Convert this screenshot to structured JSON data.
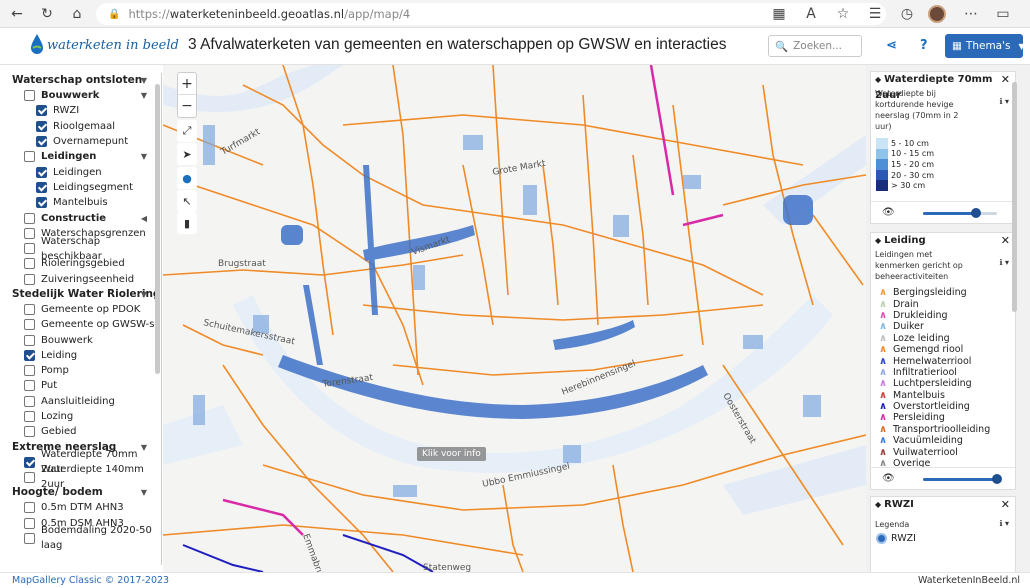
{
  "browser": {
    "url_prefix": "https://",
    "url_host": "waterketeninbeeld.geoatlas.nl",
    "url_path": "/app/map/4"
  },
  "header": {
    "logo_text": "waterketen in beeld",
    "title": "3 Afvalwaterketen van gemeenten en waterschappen op GWSW en interacties",
    "search_placeholder": "Zoeken...",
    "themas_label": "Thema's"
  },
  "left_panel": {
    "sections": [
      {
        "title": "Waterschap ontsloten",
        "rows": [
          {
            "label": "Bouwwerk",
            "level": 1,
            "bold": true,
            "checked": false,
            "arrow": "▼"
          },
          {
            "label": "RWZI",
            "level": 2,
            "checked": true
          },
          {
            "label": "Rioolgemaal",
            "level": 2,
            "checked": true
          },
          {
            "label": "Overnamepunt",
            "level": 2,
            "checked": true
          },
          {
            "label": "Leidingen",
            "level": 1,
            "bold": true,
            "checked": false,
            "arrow": "▼"
          },
          {
            "label": "Leidingen",
            "level": 2,
            "checked": true
          },
          {
            "label": "Leidingsegment",
            "level": 2,
            "checked": true
          },
          {
            "label": "Mantelbuis",
            "level": 2,
            "checked": true
          },
          {
            "label": "Constructie",
            "level": 1,
            "bold": true,
            "checked": false,
            "arrow": "◀"
          },
          {
            "label": "Waterschapsgrenzen",
            "level": 1,
            "checked": false
          },
          {
            "label": "Waterschap beschikbaar",
            "level": 1,
            "checked": false
          },
          {
            "label": "Rioleringsgebied",
            "level": 1,
            "checked": false
          },
          {
            "label": "Zuiveringseenheid",
            "level": 1,
            "checked": false
          }
        ]
      },
      {
        "title": "Stedelijk Water Riolering",
        "rows": [
          {
            "label": "Gemeente op PDOK",
            "level": 1,
            "checked": false
          },
          {
            "label": "Gemeente op GWSW-s",
            "level": 1,
            "checked": false
          },
          {
            "label": "Bouwwerk",
            "level": 1,
            "checked": false
          },
          {
            "label": "Leiding",
            "level": 1,
            "checked": true
          },
          {
            "label": "Pomp",
            "level": 1,
            "checked": false
          },
          {
            "label": "Put",
            "level": 1,
            "checked": false
          },
          {
            "label": "Aansluitleiding",
            "level": 1,
            "checked": false
          },
          {
            "label": "Lozing",
            "level": 1,
            "checked": false
          },
          {
            "label": "Gebied",
            "level": 1,
            "checked": false
          }
        ]
      },
      {
        "title": "Extreme neerslag",
        "rows": [
          {
            "label": "Waterdiepte 70mm 2uur",
            "level": 1,
            "checked": true
          },
          {
            "label": "Waterdiepte 140mm 2uur",
            "level": 1,
            "checked": false
          }
        ]
      },
      {
        "title": "Hoogte/ bodem",
        "rows": [
          {
            "label": "0.5m DTM AHN3",
            "level": 1,
            "checked": false
          },
          {
            "label": "0.5m DSM AHN3",
            "level": 1,
            "checked": false
          },
          {
            "label": "Bodemdaling 2020-50 laag",
            "level": 1,
            "checked": false
          }
        ]
      }
    ]
  },
  "map": {
    "info_label": "Klik voor info",
    "streets": [
      "Brugstraat",
      "Turfmarkt",
      "Vismarkt",
      "Torenstraat",
      "Schuitemakersstraat",
      "Ubbo Emmiussingel",
      "Herebinnensingel",
      "Oosterstraat",
      "Statenweg",
      "Emmabrug",
      "Grote Markt"
    ]
  },
  "right_panel": {
    "waterdiepte": {
      "title": "Waterdiepte 70mm 2uur",
      "desc": "Waterdiepte bij kortdurende hevige neerslag (70mm in 2 uur)",
      "legend": [
        {
          "label": "5 - 10 cm",
          "color": "#c9e4f5"
        },
        {
          "label": "10 - 15 cm",
          "color": "#8ec3ea"
        },
        {
          "label": "15 - 20 cm",
          "color": "#4f8fd6"
        },
        {
          "label": "20 - 30 cm",
          "color": "#2b58b3"
        },
        {
          "label": "> 30 cm",
          "color": "#172c7a"
        }
      ],
      "opacity": 0.72
    },
    "leiding": {
      "title": "Leiding",
      "desc": "Leidingen met kenmerken gericht op beheeractiviteiten",
      "legend": [
        {
          "label": "Bergingsleiding",
          "color": "#f29b3a"
        },
        {
          "label": "Drain",
          "color": "#b8d0b0"
        },
        {
          "label": "Drukleiding",
          "color": "#e04fb0"
        },
        {
          "label": "Duiker",
          "color": "#7fb8e6"
        },
        {
          "label": "Loze leiding",
          "color": "#bfbfbf"
        },
        {
          "label": "Gemengd riool",
          "color": "#f08a26"
        },
        {
          "label": "Hemelwaterriool",
          "color": "#2b3fd0"
        },
        {
          "label": "Infiltratieriool",
          "color": "#93a7e0"
        },
        {
          "label": "Luchtpersleiding",
          "color": "#c979e0"
        },
        {
          "label": "Mantelbuis",
          "color": "#d03b3b"
        },
        {
          "label": "Overstortleiding",
          "color": "#1f1fc0"
        },
        {
          "label": "Persleiding",
          "color": "#d82aa8"
        },
        {
          "label": "Transportrioolleiding",
          "color": "#e06a2a"
        },
        {
          "label": "Vacuümleiding",
          "color": "#3a7de0"
        },
        {
          "label": "Vuilwaterriool",
          "color": "#9c3a3a"
        },
        {
          "label": "Overige",
          "color": "#8a8a8a"
        }
      ],
      "opacity": 1.0
    },
    "rwzi": {
      "title": "RWZI",
      "legend_title": "Legenda",
      "item": "RWZI"
    }
  },
  "footer": {
    "left": "MapGallery Classic © 2017-2023",
    "right": "WaterketenInBeeld.nl"
  }
}
